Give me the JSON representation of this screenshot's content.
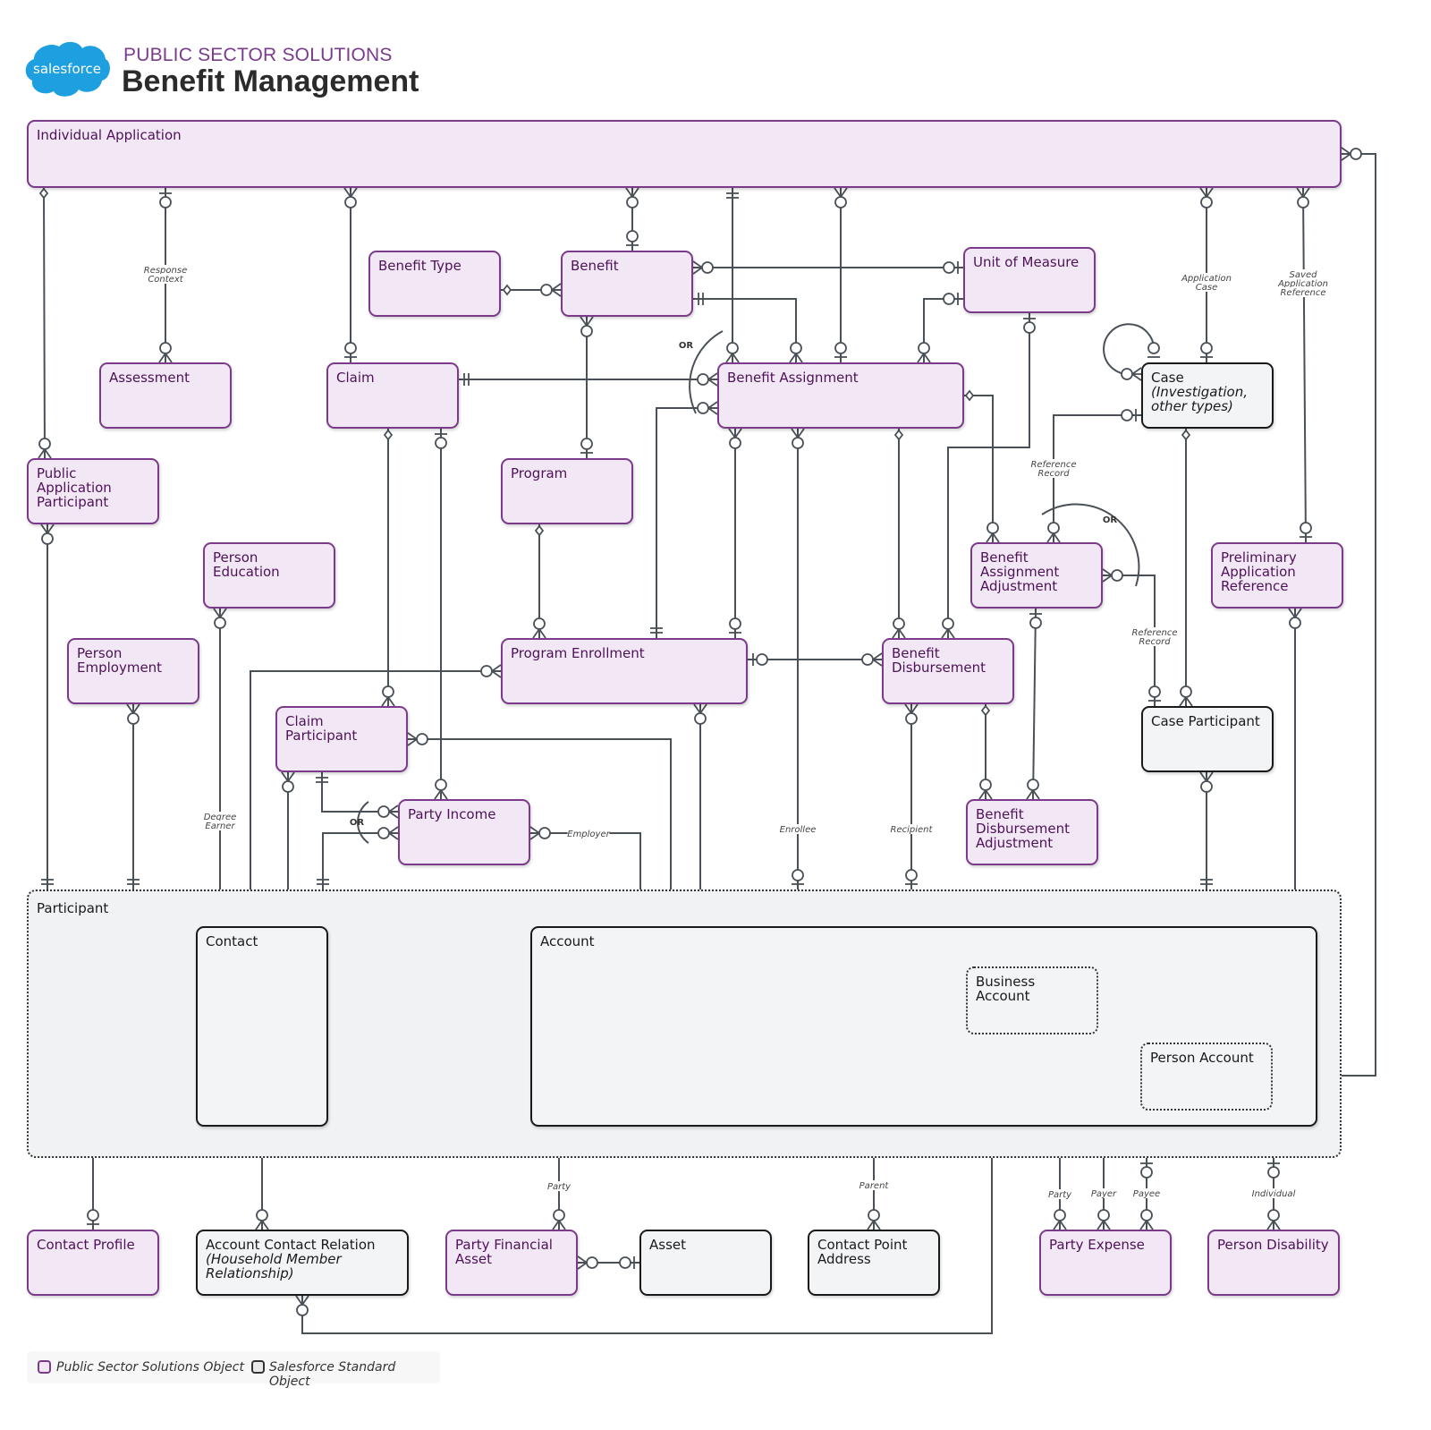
{
  "header": {
    "logo_text": "salesforce",
    "subtitle": "PUBLIC SECTOR SOLUTIONS",
    "title": "Benefit Management"
  },
  "colors": {
    "pss_fill": "#f2e8f5",
    "pss_border": "#7b3a8a",
    "std_fill": "#f3f4f6",
    "std_border": "#1a1a1a",
    "line": "#4a5058",
    "logo_blue": "#1e9fe0"
  },
  "entities": {
    "individual_application": {
      "name": "Individual Application",
      "type": "pss"
    },
    "benefit_type": {
      "name": "Benefit Type",
      "type": "pss"
    },
    "benefit": {
      "name": "Benefit",
      "type": "pss"
    },
    "unit_of_measure": {
      "name": "Unit of Measure",
      "type": "pss"
    },
    "assessment": {
      "name": "Assessment",
      "type": "pss"
    },
    "claim": {
      "name": "Claim",
      "type": "pss"
    },
    "benefit_assignment": {
      "name": "Benefit Assignment",
      "type": "pss"
    },
    "case": {
      "name": "Case",
      "note": "(Investigation, other types)",
      "type": "std"
    },
    "public_application_participant": {
      "name": "Public Application Participant",
      "type": "pss"
    },
    "program": {
      "name": "Program",
      "type": "pss"
    },
    "benefit_assignment_adjustment": {
      "name": "Benefit Assignment Adjustment",
      "type": "pss"
    },
    "preliminary_application_reference": {
      "name": "Preliminary Application Reference",
      "type": "pss"
    },
    "person_education": {
      "name": "Person Education",
      "type": "pss"
    },
    "person_employment": {
      "name": "Person Employment",
      "type": "pss"
    },
    "program_enrollment": {
      "name": "Program Enrollment",
      "type": "pss"
    },
    "benefit_disbursement": {
      "name": "Benefit Disbursement",
      "type": "pss"
    },
    "case_participant": {
      "name": "Case Participant",
      "type": "std"
    },
    "claim_participant": {
      "name": "Claim Participant",
      "type": "pss"
    },
    "party_income": {
      "name": "Party Income",
      "type": "pss"
    },
    "benefit_disbursement_adjustment": {
      "name": "Benefit Disbursement Adjustment",
      "type": "pss"
    },
    "participant": {
      "name": "Participant",
      "type": "group"
    },
    "contact": {
      "name": "Contact",
      "type": "std"
    },
    "account": {
      "name": "Account",
      "type": "std"
    },
    "business_account": {
      "name": "Business Account",
      "type": "virtual"
    },
    "person_account": {
      "name": "Person Account",
      "type": "virtual"
    },
    "contact_profile": {
      "name": "Contact Profile",
      "type": "pss"
    },
    "account_contact_relation": {
      "name": "Account Contact Relation",
      "note": "(Household Member Relationship)",
      "type": "std"
    },
    "party_financial_asset": {
      "name": "Party Financial Asset",
      "type": "pss"
    },
    "asset": {
      "name": "Asset",
      "type": "std"
    },
    "contact_point_address": {
      "name": "Contact Point Address",
      "type": "std"
    },
    "party_expense": {
      "name": "Party Expense",
      "type": "pss"
    },
    "person_disability": {
      "name": "Person Disability",
      "type": "pss"
    }
  },
  "relationship_labels": {
    "response_context": "Response Context",
    "application_case": "Application Case",
    "saved_application_reference": "Saved Application Reference",
    "reference_record_1": "Reference Record",
    "reference_record_2": "Reference Record",
    "degree_earner": "Degree Earner",
    "employer": "Employer",
    "enrollee": "Enrollee",
    "recipient": "Recipient",
    "party_1": "Party",
    "parent": "Parent",
    "party_2": "Party",
    "payer": "Payer",
    "payee": "Payee",
    "individual": "Individual",
    "or": "OR"
  },
  "legend": {
    "pss": "Public Sector Solutions Object",
    "std": "Salesforce Standard Object"
  }
}
